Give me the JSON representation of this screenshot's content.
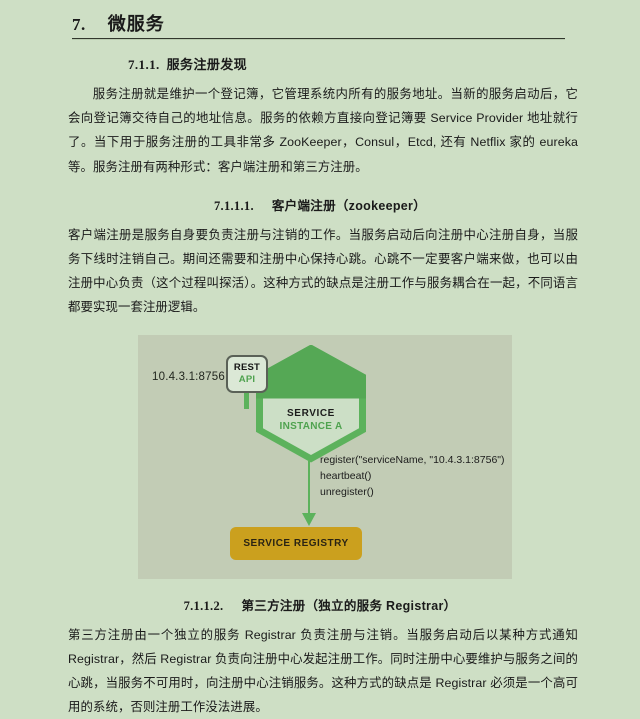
{
  "document": {
    "section_number": "7.",
    "section_title": "微服务",
    "h2": {
      "num": "7.1.1.",
      "title": "服务注册发现"
    },
    "p1": "服务注册就是维护一个登记簿，它管理系统内所有的服务地址。当新的服务启动后，它会向登记簿交待自己的地址信息。服务的依赖方直接向登记簿要 Service Provider 地址就行了。当下用于服务注册的工具非常多 ZooKeeper，Consul，Etcd, 还有 Netflix 家的 eureka 等。服务注册有两种形式：客户端注册和第三方注册。",
    "h3_a": {
      "num": "7.1.1.1.",
      "title": "客户端注册（zookeeper）"
    },
    "p2": "客户端注册是服务自身要负责注册与注销的工作。当服务启动后向注册中心注册自身，当服务下线时注销自己。期间还需要和注册中心保持心跳。心跳不一定要客户端来做，也可以由注册中心负责（这个过程叫探活）。这种方式的缺点是注册工作与服务耦合在一起，不同语言都要实现一套注册逻辑。",
    "h3_b": {
      "num": "7.1.1.2.",
      "title": "第三方注册（独立的服务 Registrar）"
    },
    "p3": "第三方注册由一个独立的服务 Registrar 负责注册与注销。当服务启动后以某种方式通知 Registrar，然后 Registrar 负责向注册中心发起注册工作。同时注册中心要维护与服务之间的心跳，当服务不可用时，向注册中心注销服务。这种方式的缺点是 Registrar 必须是一个高可用的系统，否则注册工作没法进展。"
  },
  "diagram": {
    "ip_label": "10.4.3.1:8756",
    "rest_box": {
      "line1": "REST",
      "line2": "API"
    },
    "service_node": {
      "line1": "SERVICE",
      "line2": "INSTANCE A"
    },
    "calls": {
      "line1": "register(\"serviceName, \"10.4.3.1:8756\")",
      "line2": "heartbeat()",
      "line3": "unregister()"
    },
    "registry_label": "SERVICE REGISTRY",
    "colors": {
      "page_background": "#cedfc5",
      "panel_background": "#c2ccb5",
      "node_green": "#5cb25c",
      "node_fill": "#ccdfc6",
      "registry_gold": "#cba01e",
      "rest_border": "#5a6157"
    }
  }
}
